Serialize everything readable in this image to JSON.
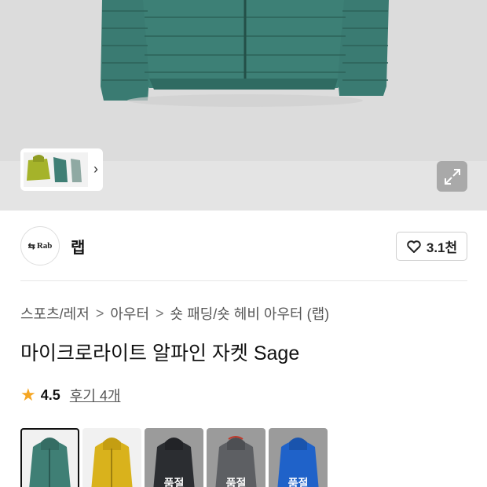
{
  "brand": {
    "logo_text": "Rab",
    "name": "랩"
  },
  "likes": {
    "count": "3.1천"
  },
  "breadcrumb": [
    {
      "label": "스포츠/레저"
    },
    {
      "label": "아우터"
    },
    {
      "label": "숏 패딩/숏 헤비 아우터 (랩)"
    }
  ],
  "breadcrumb_separator": ">",
  "product": {
    "title": "마이크로라이트 알파인 자켓 Sage"
  },
  "rating": {
    "score": "4.5",
    "reviews_label": "후기 4개"
  },
  "gallery": {
    "more_icon": "chevron-right-icon",
    "expand_icon": "expand-icon"
  },
  "variants": [
    {
      "color": "#3f7f75",
      "selected": true,
      "sold_out": false,
      "label": ""
    },
    {
      "color": "#d9b21c",
      "selected": false,
      "sold_out": false,
      "label": ""
    },
    {
      "color": "#2b2d31",
      "selected": false,
      "sold_out": true,
      "label": "품절"
    },
    {
      "color": "#5d5f63",
      "selected": false,
      "sold_out": true,
      "label": "품절"
    },
    {
      "color": "#1f62c9",
      "selected": false,
      "sold_out": true,
      "label": "품절"
    }
  ],
  "colors": {
    "jacket": "#3d8076",
    "star": "#f5a623"
  }
}
